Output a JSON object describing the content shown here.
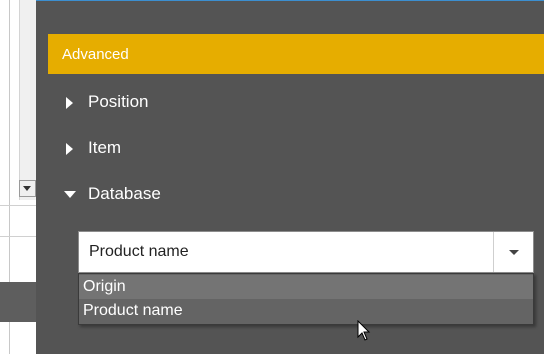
{
  "panel": {
    "header_label": "Advanced",
    "sections": [
      {
        "label": "Position",
        "expanded": false
      },
      {
        "label": "Item",
        "expanded": false
      },
      {
        "label": "Database",
        "expanded": true
      }
    ]
  },
  "combo": {
    "value": "Product name",
    "options": [
      "Origin",
      "Product name"
    ],
    "highlighted_option": "Origin"
  },
  "colors": {
    "panel_bg": "#545454",
    "accent_header": "#e6ad00",
    "dropdown_bg": "#646464",
    "highlight_bg": "#747474"
  },
  "icons": {
    "collapsed": "triangle-right-icon",
    "expanded": "triangle-down-icon",
    "combo_chevron": "chevron-down-icon",
    "pointer": "mouse-cursor-icon"
  }
}
